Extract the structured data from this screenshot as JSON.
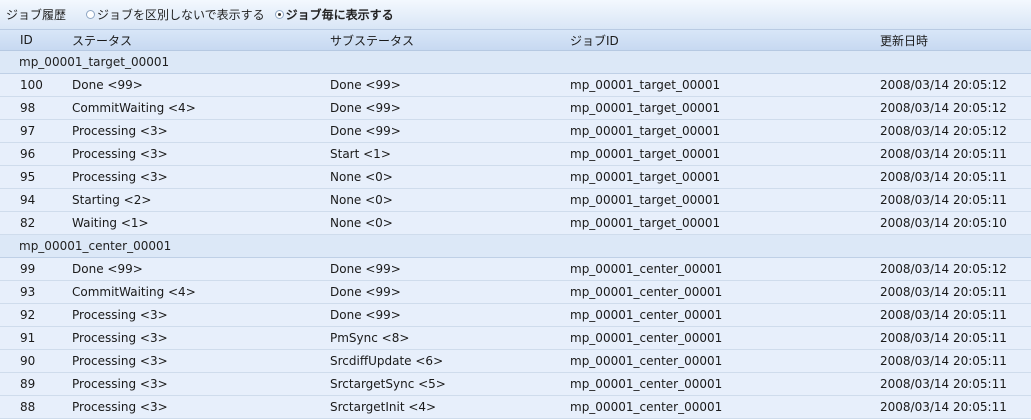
{
  "toolbar": {
    "title": "ジョブ履歴",
    "options": [
      {
        "label": "ジョブを区別しないで表示する",
        "selected": false
      },
      {
        "label": "ジョブ毎に表示する",
        "selected": true
      }
    ]
  },
  "table": {
    "columns": {
      "id": "ID",
      "status": "ステータス",
      "substatus": "サブステータス",
      "jobid": "ジョブID",
      "updated": "更新日時"
    },
    "groups": [
      {
        "name": "mp_00001_target_00001",
        "rows": [
          {
            "id": "100",
            "status": "Done <99>",
            "substatus": "Done <99>",
            "jobid": "mp_00001_target_00001",
            "updated": "2008/03/14 20:05:12"
          },
          {
            "id": "98",
            "status": "CommitWaiting <4>",
            "substatus": "Done <99>",
            "jobid": "mp_00001_target_00001",
            "updated": "2008/03/14 20:05:12"
          },
          {
            "id": "97",
            "status": "Processing <3>",
            "substatus": "Done <99>",
            "jobid": "mp_00001_target_00001",
            "updated": "2008/03/14 20:05:12"
          },
          {
            "id": "96",
            "status": "Processing <3>",
            "substatus": "Start <1>",
            "jobid": "mp_00001_target_00001",
            "updated": "2008/03/14 20:05:11"
          },
          {
            "id": "95",
            "status": "Processing <3>",
            "substatus": "None <0>",
            "jobid": "mp_00001_target_00001",
            "updated": "2008/03/14 20:05:11"
          },
          {
            "id": "94",
            "status": "Starting <2>",
            "substatus": "None <0>",
            "jobid": "mp_00001_target_00001",
            "updated": "2008/03/14 20:05:11"
          },
          {
            "id": "82",
            "status": "Waiting <1>",
            "substatus": "None <0>",
            "jobid": "mp_00001_target_00001",
            "updated": "2008/03/14 20:05:10"
          }
        ]
      },
      {
        "name": "mp_00001_center_00001",
        "rows": [
          {
            "id": "99",
            "status": "Done <99>",
            "substatus": "Done <99>",
            "jobid": "mp_00001_center_00001",
            "updated": "2008/03/14 20:05:12"
          },
          {
            "id": "93",
            "status": "CommitWaiting <4>",
            "substatus": "Done <99>",
            "jobid": "mp_00001_center_00001",
            "updated": "2008/03/14 20:05:11"
          },
          {
            "id": "92",
            "status": "Processing <3>",
            "substatus": "Done <99>",
            "jobid": "mp_00001_center_00001",
            "updated": "2008/03/14 20:05:11"
          },
          {
            "id": "91",
            "status": "Processing <3>",
            "substatus": "PmSync <8>",
            "jobid": "mp_00001_center_00001",
            "updated": "2008/03/14 20:05:11"
          },
          {
            "id": "90",
            "status": "Processing <3>",
            "substatus": "SrcdiffUpdate <6>",
            "jobid": "mp_00001_center_00001",
            "updated": "2008/03/14 20:05:11"
          },
          {
            "id": "89",
            "status": "Processing <3>",
            "substatus": "SrctargetSync <5>",
            "jobid": "mp_00001_center_00001",
            "updated": "2008/03/14 20:05:11"
          },
          {
            "id": "88",
            "status": "Processing <3>",
            "substatus": "SrctargetInit <4>",
            "jobid": "mp_00001_center_00001",
            "updated": "2008/03/14 20:05:11"
          }
        ]
      }
    ]
  }
}
